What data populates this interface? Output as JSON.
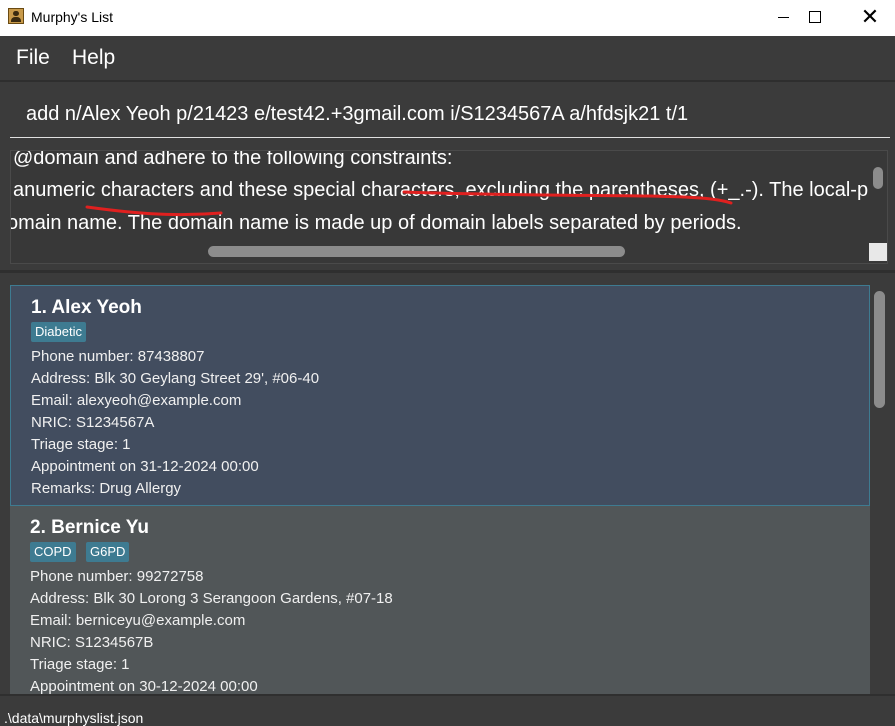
{
  "window": {
    "title": "Murphy's List"
  },
  "menu": {
    "file": "File",
    "help": "Help"
  },
  "command": {
    "value": "add n/Alex Yeoh p/21423 e/test42.+3gmail.com i/S1234567A a/hfdsjk21 t/1"
  },
  "result": {
    "lines": [
      "@domain and adhere to the following constraints:",
      "anumeric characters and these special characters, excluding the parentheses, (+_.-). The local-p",
      "omain name. The domain name is made up of domain labels separated by periods."
    ],
    "annotation_color": "#e0201f"
  },
  "persons": [
    {
      "index_name": "1.  Alex Yeoh",
      "tags": [
        "Diabetic"
      ],
      "phone": "Phone number: 87438807",
      "address": "Address: Blk 30 Geylang Street 29', #06-40",
      "email": "Email: alexyeoh@example.com",
      "nric": "NRIC: S1234567A",
      "triage": "Triage stage: 1",
      "appointment": "Appointment on 31-12-2024 00:00",
      "remarks": "Remarks: Drug Allergy",
      "selected": true
    },
    {
      "index_name": "2.  Bernice Yu",
      "tags": [
        "COPD",
        "G6PD"
      ],
      "phone": "Phone number: 99272758",
      "address": "Address: Blk 30 Lorong 3 Serangoon Gardens, #07-18",
      "email": "Email: berniceyu@example.com",
      "nric": "NRIC: S1234567B",
      "triage": "Triage stage: 1",
      "appointment": "Appointment on 30-12-2024 00:00",
      "selected": false
    }
  ],
  "status": {
    "path": ".\\data\\murphyslist.json"
  },
  "colors": {
    "background": "#3b3b3b",
    "selected_card": "#424d5f",
    "card": "#515658",
    "tag": "#3e7b91"
  },
  "icons": {
    "app": "user-icon",
    "minimize": "minimize-icon",
    "maximize": "maximize-icon",
    "close": "close-icon"
  }
}
